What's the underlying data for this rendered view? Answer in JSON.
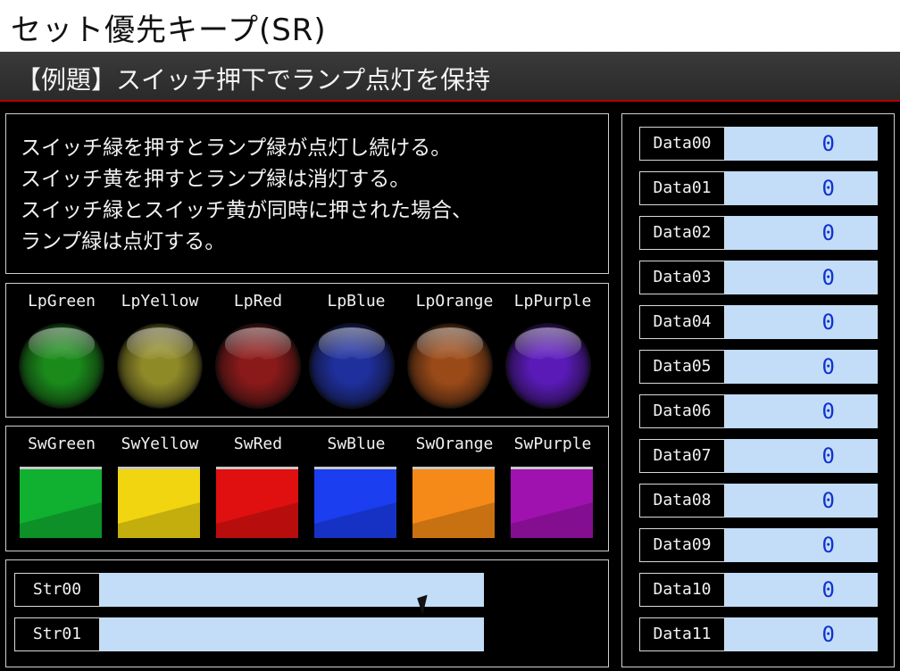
{
  "window": {
    "title": "セット優先キープ(SR)"
  },
  "header": {
    "subtitle": "【例題】スイッチ押下でランプ点灯を保持"
  },
  "description": {
    "lines": [
      "スイッチ緑を押すとランプ緑が点灯し続ける。",
      "スイッチ黄を押すとランプ緑は消灯する。",
      "スイッチ緑とスイッチ黄が同時に押された場合、",
      "ランプ緑は点灯する。"
    ]
  },
  "lamps": [
    {
      "label": "LpGreen",
      "color": "#1a8a1a"
    },
    {
      "label": "LpYellow",
      "color": "#8f8a28"
    },
    {
      "label": "LpRed",
      "color": "#8a1a1a"
    },
    {
      "label": "LpBlue",
      "color": "#1f2f9c"
    },
    {
      "label": "LpOrange",
      "color": "#9a4a18"
    },
    {
      "label": "LpPurple",
      "color": "#5a1ab8"
    }
  ],
  "switches": [
    {
      "label": "SwGreen",
      "color": "#10b030"
    },
    {
      "label": "SwYellow",
      "color": "#f0d510"
    },
    {
      "label": "SwRed",
      "color": "#e01010"
    },
    {
      "label": "SwBlue",
      "color": "#1a3ef0"
    },
    {
      "label": "SwOrange",
      "color": "#f58a18"
    },
    {
      "label": "SwPurple",
      "color": "#a012b0"
    }
  ],
  "strings": [
    {
      "label": "Str00",
      "value": ""
    },
    {
      "label": "Str01",
      "value": ""
    }
  ],
  "data": [
    {
      "label": "Data00",
      "value": "0"
    },
    {
      "label": "Data01",
      "value": "0"
    },
    {
      "label": "Data02",
      "value": "0"
    },
    {
      "label": "Data03",
      "value": "0"
    },
    {
      "label": "Data04",
      "value": "0"
    },
    {
      "label": "Data05",
      "value": "0"
    },
    {
      "label": "Data06",
      "value": "0"
    },
    {
      "label": "Data07",
      "value": "0"
    },
    {
      "label": "Data08",
      "value": "0"
    },
    {
      "label": "Data09",
      "value": "0"
    },
    {
      "label": "Data10",
      "value": "0"
    },
    {
      "label": "Data11",
      "value": "0"
    }
  ]
}
